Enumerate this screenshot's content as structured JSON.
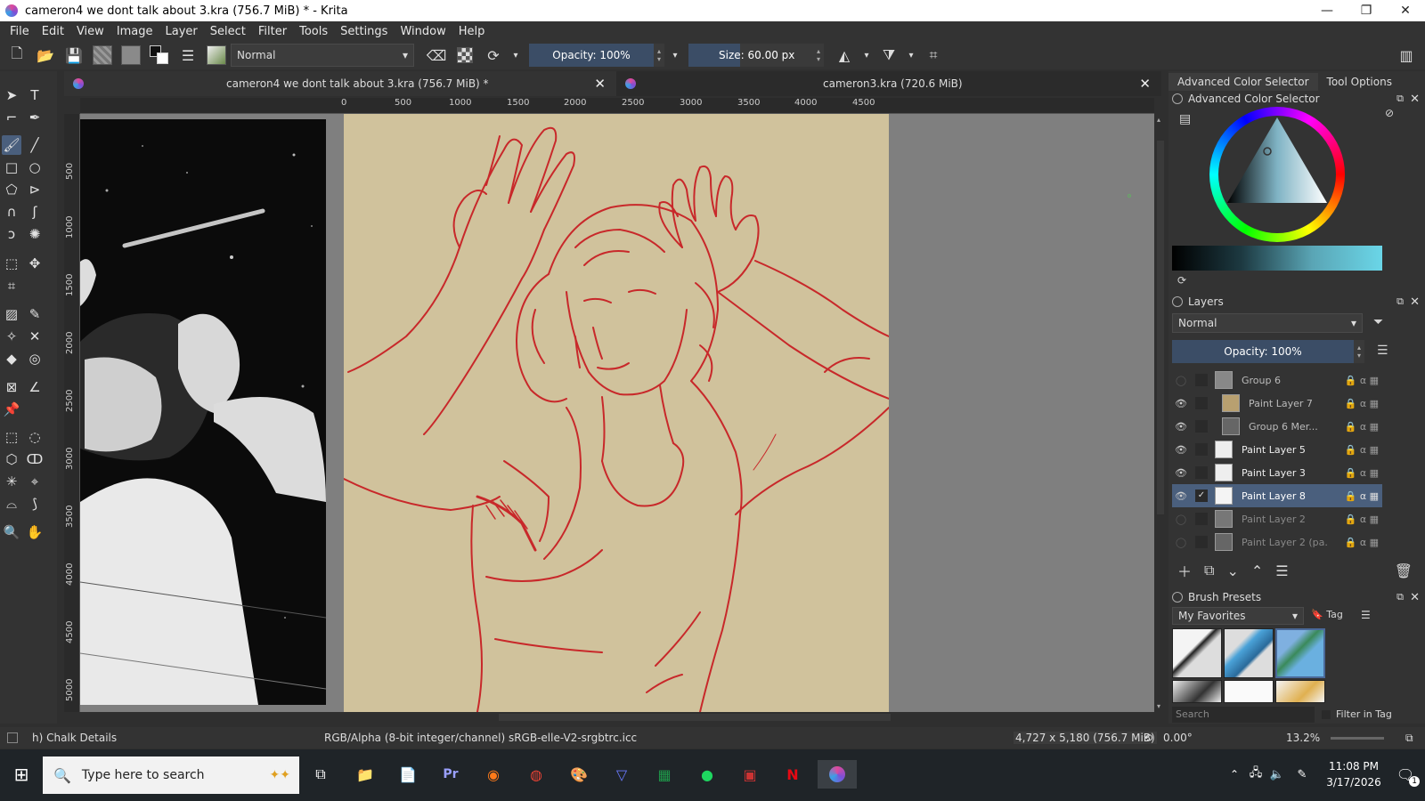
{
  "window": {
    "title": "cameron4 we dont talk about 3.kra (756.7 MiB) * - Krita"
  },
  "menubar": [
    "File",
    "Edit",
    "View",
    "Image",
    "Layer",
    "Select",
    "Filter",
    "Tools",
    "Settings",
    "Window",
    "Help"
  ],
  "toolbar": {
    "blend_mode": "Normal",
    "opacity_label": "Opacity: 100%",
    "size_label": "Size: 60.00 px"
  },
  "tabs": [
    {
      "label": "cameron4 we dont talk about 3.kra (756.7 MiB) *"
    },
    {
      "label": "cameron3.kra (720.6 MiB)"
    }
  ],
  "rulers": {
    "horizontal": [
      "0",
      "500",
      "1000",
      "1500",
      "2000",
      "2500",
      "3000",
      "3500",
      "4000",
      "4500"
    ],
    "vertical": [
      "500",
      "1000",
      "1500",
      "2000",
      "2500",
      "3000",
      "3500",
      "4000",
      "4500",
      "5000"
    ]
  },
  "dock": {
    "tabs": [
      "Advanced Color Selector",
      "Tool Options"
    ],
    "color_selector_title": "Advanced Color Selector",
    "layers_title": "Layers",
    "layers_blend": "Normal",
    "layers_opacity": "Opacity:  100%",
    "layers": [
      {
        "name": "Group 6",
        "visible": false
      },
      {
        "name": "Paint Layer 7",
        "visible": true
      },
      {
        "name": "Group 6 Mer...",
        "visible": true
      },
      {
        "name": "Paint Layer 5",
        "visible": true
      },
      {
        "name": "Paint Layer 3",
        "visible": true
      },
      {
        "name": "Paint Layer 8",
        "visible": true,
        "selected": true
      },
      {
        "name": "Paint Layer 2",
        "visible": false
      },
      {
        "name": "Paint Layer 2 (pa...",
        "visible": false
      }
    ],
    "brush_presets_title": "Brush Presets",
    "brush_tag": "My Favorites",
    "tag_label": "Tag",
    "search_placeholder": "Search",
    "filter_in_tag": "Filter in Tag"
  },
  "status": {
    "brush": "h) Chalk Details",
    "color_space": "RGB/Alpha (8-bit integer/channel)  sRGB-elle-V2-srgbtrc.icc",
    "dimensions": "4,727 x 5,180 (756.7 MiB)",
    "rotation": "0.00°",
    "zoom": "13.2%"
  },
  "taskbar": {
    "search_placeholder": "Type here to search",
    "time": "11:08 PM",
    "date": "3/17/2026",
    "notifications": "1"
  },
  "colors": {
    "accent": "#4a5f7d",
    "paper": "#d0c29c",
    "sketch_line": "#c8282a"
  }
}
